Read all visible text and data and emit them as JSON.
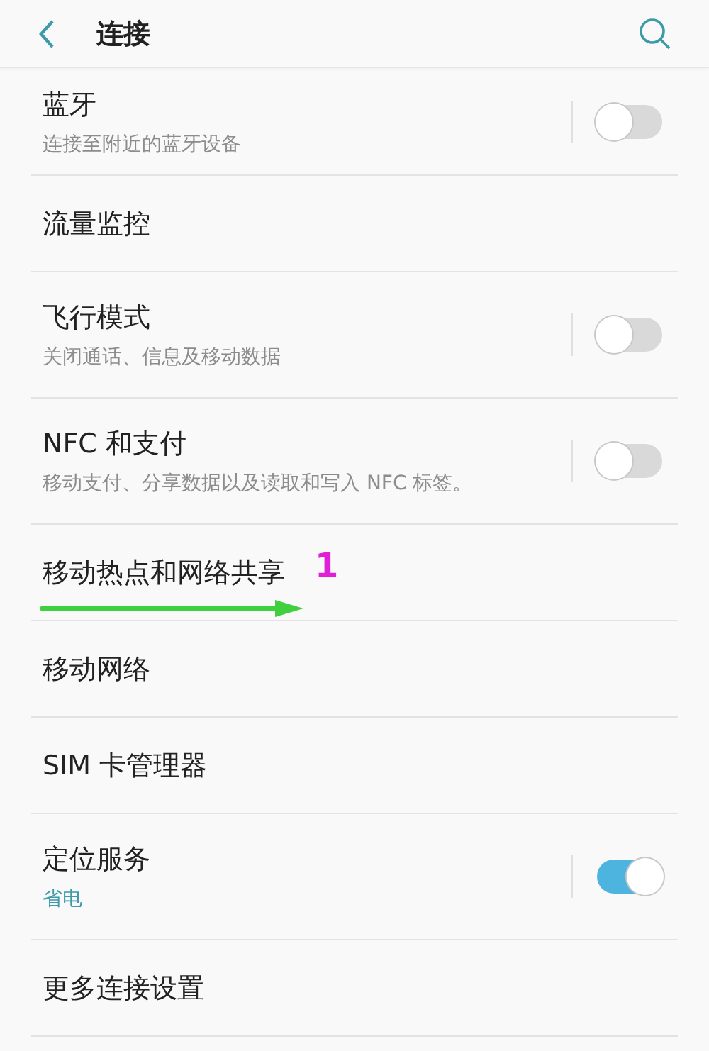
{
  "header": {
    "title": "连接"
  },
  "items": [
    {
      "kind": "toggle",
      "title": "蓝牙",
      "subtitle": "连接至附近的蓝牙设备",
      "subtitle_accent": false,
      "on": false
    },
    {
      "kind": "link",
      "title": "流量监控"
    },
    {
      "kind": "toggle",
      "title": "飞行模式",
      "subtitle": "关闭通话、信息及移动数据",
      "subtitle_accent": false,
      "on": false
    },
    {
      "kind": "toggle",
      "title": "NFC 和支付",
      "subtitle": "移动支付、分享数据以及读取和写入 NFC 标签。",
      "subtitle_accent": false,
      "on": false
    },
    {
      "kind": "link",
      "title": "移动热点和网络共享",
      "annotation": "1"
    },
    {
      "kind": "link",
      "title": "移动网络"
    },
    {
      "kind": "link",
      "title": "SIM 卡管理器"
    },
    {
      "kind": "toggle",
      "title": "定位服务",
      "subtitle": "省电",
      "subtitle_accent": true,
      "on": true
    },
    {
      "kind": "link",
      "title": "更多连接设置"
    }
  ]
}
